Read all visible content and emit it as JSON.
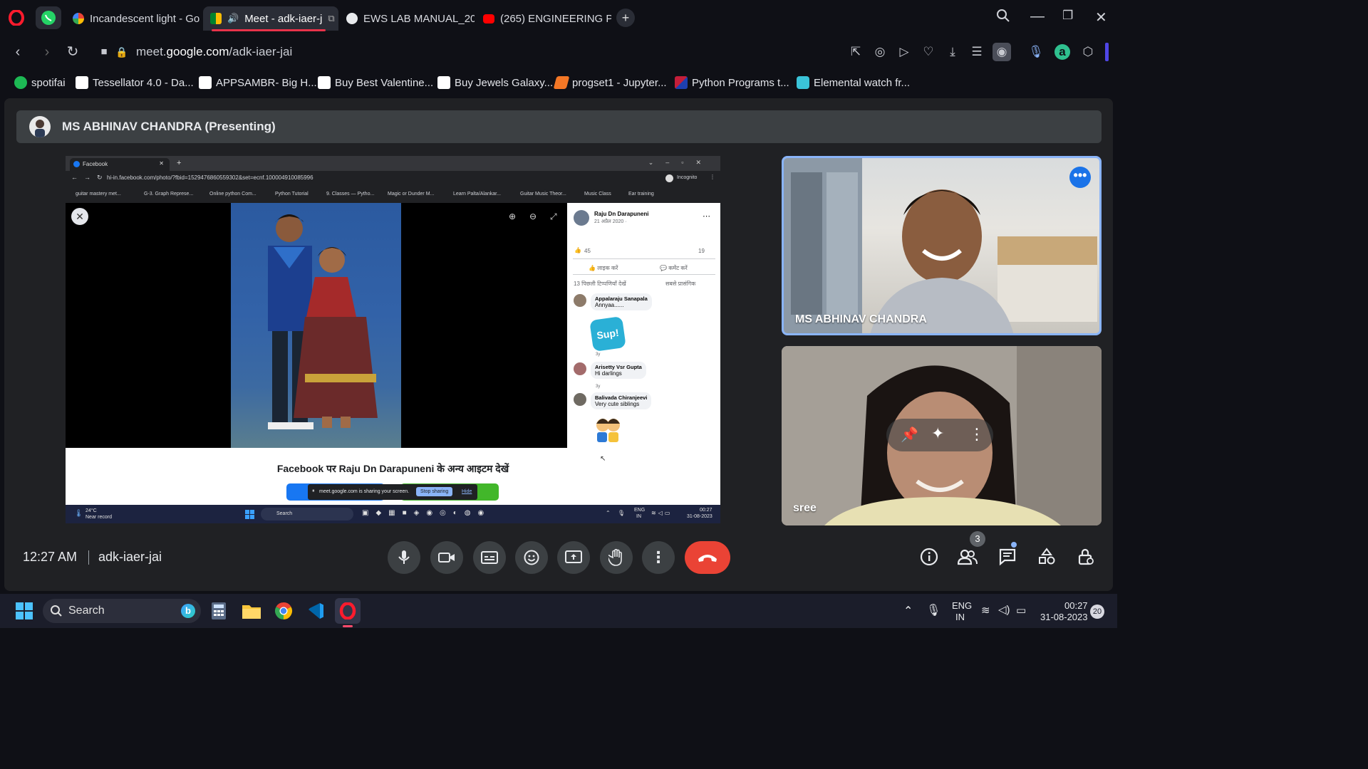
{
  "browser": {
    "tabs": [
      {
        "label": "Incandescent light - Go",
        "active": false
      },
      {
        "label": "Meet - adk-iaer-j",
        "active": true
      },
      {
        "label": "EWS LAB MANUAL_20.1",
        "active": false
      },
      {
        "label": "(265) ENGINEERING PR/",
        "active": false
      }
    ],
    "url_plain": "meet.",
    "url_bold": "google.com",
    "url_path": "/adk-iaer-jai",
    "bookmarks": [
      "spotifai",
      "Tessellator 4.0 - Da...",
      "APPSAMBR- Big H...",
      "Buy Best Valentine...",
      "Buy Jewels Galaxy...",
      "progset1 - Jupyter...",
      "Python Programs t...",
      "Elemental watch fr..."
    ]
  },
  "meet": {
    "presenter_banner": "MS ABHINAV CHANDRA (Presenting)",
    "participants": [
      {
        "name": "MS ABHINAV CHANDRA"
      },
      {
        "name": "sree"
      }
    ],
    "time": "12:27 AM",
    "meeting_code": "adk-iaer-jai",
    "people_count": "3"
  },
  "shared_screen": {
    "tab_title": "Facebook",
    "url": "hi-in.facebook.com/photo/?fbid=1529476860559302&set=ecnf.100004910085996",
    "incognito": "Incognito",
    "bookmarks": [
      "guitar mastery met...",
      "G-3. Graph Represe...",
      "Online python Com...",
      "Python Tutorial",
      "9. Classes — Pytho...",
      "Magic or Dunder M...",
      "Learn Palta/Alankar...",
      "Guitar Music Theor...",
      "Music Class",
      "Ear training"
    ],
    "post_author": "Raju Dn Darapuneni",
    "post_date": "21 अप्रैल 2020 · ",
    "likes": "45",
    "comments_count": "19",
    "like_btn": "लाइक करें",
    "comment_btn": "कमेंट करें",
    "prev_comments": "13 पिछली टिप्पणियाँ देखें",
    "sort": "सबसे प्रासंगिक",
    "comments": [
      {
        "name": "Appalaraju Sanapala",
        "text": "Annyaa......",
        "time": "3y"
      },
      {
        "name": "Arisetty Vsr Gupta",
        "text": "Hi darlings",
        "time": "3y"
      },
      {
        "name": "Balivada Chiranjeevi",
        "text": "Very cute siblings",
        "time": ""
      }
    ],
    "sticker_text": "Sup!",
    "more_title": "Facebook पर Raju Dn Darapuneni के अन्य आइटम देखें",
    "sharing_text": "meet.google.com is sharing your screen.",
    "stop_sharing": "Stop sharing",
    "hide": "Hide",
    "weather_temp": "24°C",
    "weather_desc": "Near record",
    "search": "Search",
    "lang": "ENG",
    "region": "IN",
    "time": "00:27",
    "date": "31-08-2023"
  },
  "taskbar": {
    "search": "Search",
    "lang": "ENG",
    "region": "IN",
    "time": "00:27",
    "date": "31-08-2023",
    "notifications": "20"
  },
  "colors": {
    "accent": "#8ab4f8",
    "end_call": "#ea4335",
    "active_tab_underline": "#e8334a"
  }
}
